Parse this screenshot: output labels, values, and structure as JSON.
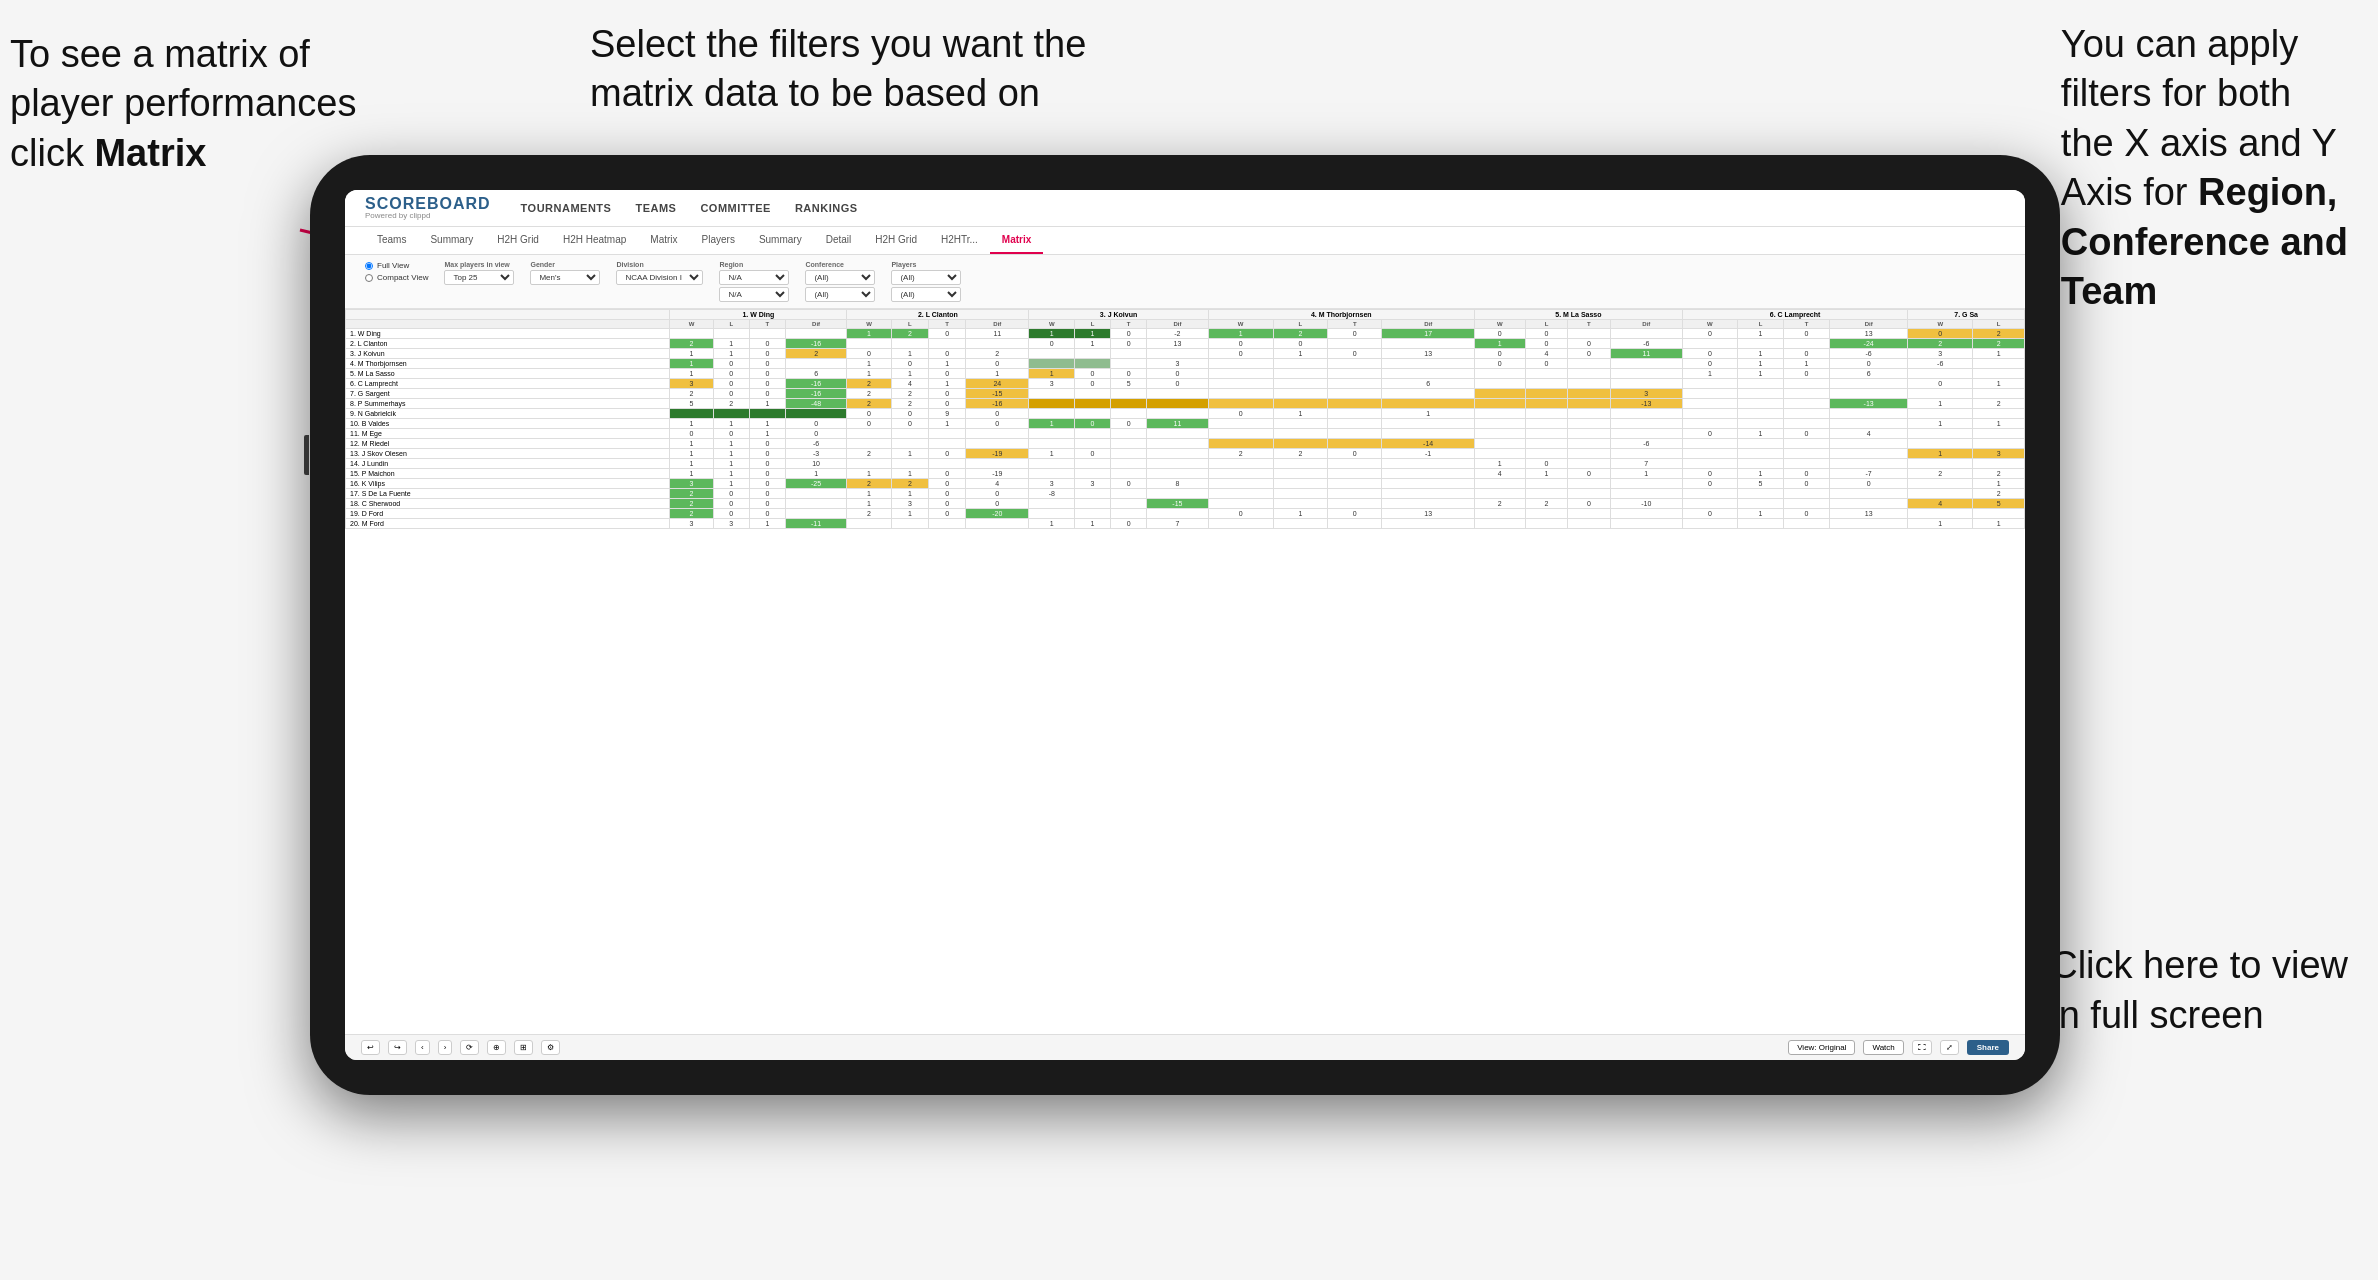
{
  "annotations": {
    "topleft": {
      "line1": "To see a matrix of",
      "line2": "player performances",
      "line3_prefix": "click ",
      "line3_bold": "Matrix"
    },
    "topcenter": {
      "text": "Select the filters you want the matrix data to be based on"
    },
    "topright": {
      "line1": "You  can apply",
      "line2": "filters for both",
      "line3": "the X axis and Y",
      "line4_prefix": "Axis for ",
      "line4_bold": "Region,",
      "line5_bold": "Conference and",
      "line6_bold": "Team"
    },
    "bottomright": {
      "line1": "Click here to view",
      "line2": "in full screen"
    }
  },
  "app": {
    "logo_title": "SCOREBOARD",
    "logo_sub": "Powered by clippd",
    "nav": [
      "TOURNAMENTS",
      "TEAMS",
      "COMMITTEE",
      "RANKINGS"
    ],
    "subtabs": [
      "Teams",
      "Summary",
      "H2H Grid",
      "H2H Heatmap",
      "Matrix",
      "Players",
      "Summary",
      "Detail",
      "H2H Grid",
      "H2HTr...",
      "Matrix"
    ],
    "active_subtab": "Matrix"
  },
  "filters": {
    "view_options": [
      "Full View",
      "Compact View"
    ],
    "max_players_label": "Max players in view",
    "max_players_value": "Top 25",
    "gender_label": "Gender",
    "gender_value": "Men's",
    "division_label": "Division",
    "division_value": "NCAA Division I",
    "region_label": "Region",
    "region_value1": "N/A",
    "region_value2": "N/A",
    "conference_label": "Conference",
    "conference_value1": "(All)",
    "conference_value2": "(All)",
    "players_label": "Players",
    "players_value1": "(All)",
    "players_value2": "(All)"
  },
  "matrix": {
    "col_headers": [
      "1. W Ding",
      "2. L Clanton",
      "3. J Koivun",
      "4. M Thorbjornsen",
      "5. M La Sasso",
      "6. C Lamprecht",
      "7. G Sa"
    ],
    "subheaders": [
      "W",
      "L",
      "T",
      "Dif"
    ],
    "players": [
      "1. W Ding",
      "2. L Clanton",
      "3. J Koivun",
      "4. M Thorbjornsen",
      "5. M La Sasso",
      "6. C Lamprecht",
      "7. G Sargent",
      "8. P Summerhays",
      "9. N Gabrielcik",
      "10. B Valdes",
      "11. M Ege",
      "12. M Riedel",
      "13. J Skov Olesen",
      "14. J Lundin",
      "15. P Maichon",
      "16. K Vilips",
      "17. S De La Fuente",
      "18. C Sherwood",
      "19. D Ford",
      "20. M Ford"
    ]
  },
  "toolbar": {
    "view_original": "View: Original",
    "watch": "Watch",
    "share": "Share"
  }
}
